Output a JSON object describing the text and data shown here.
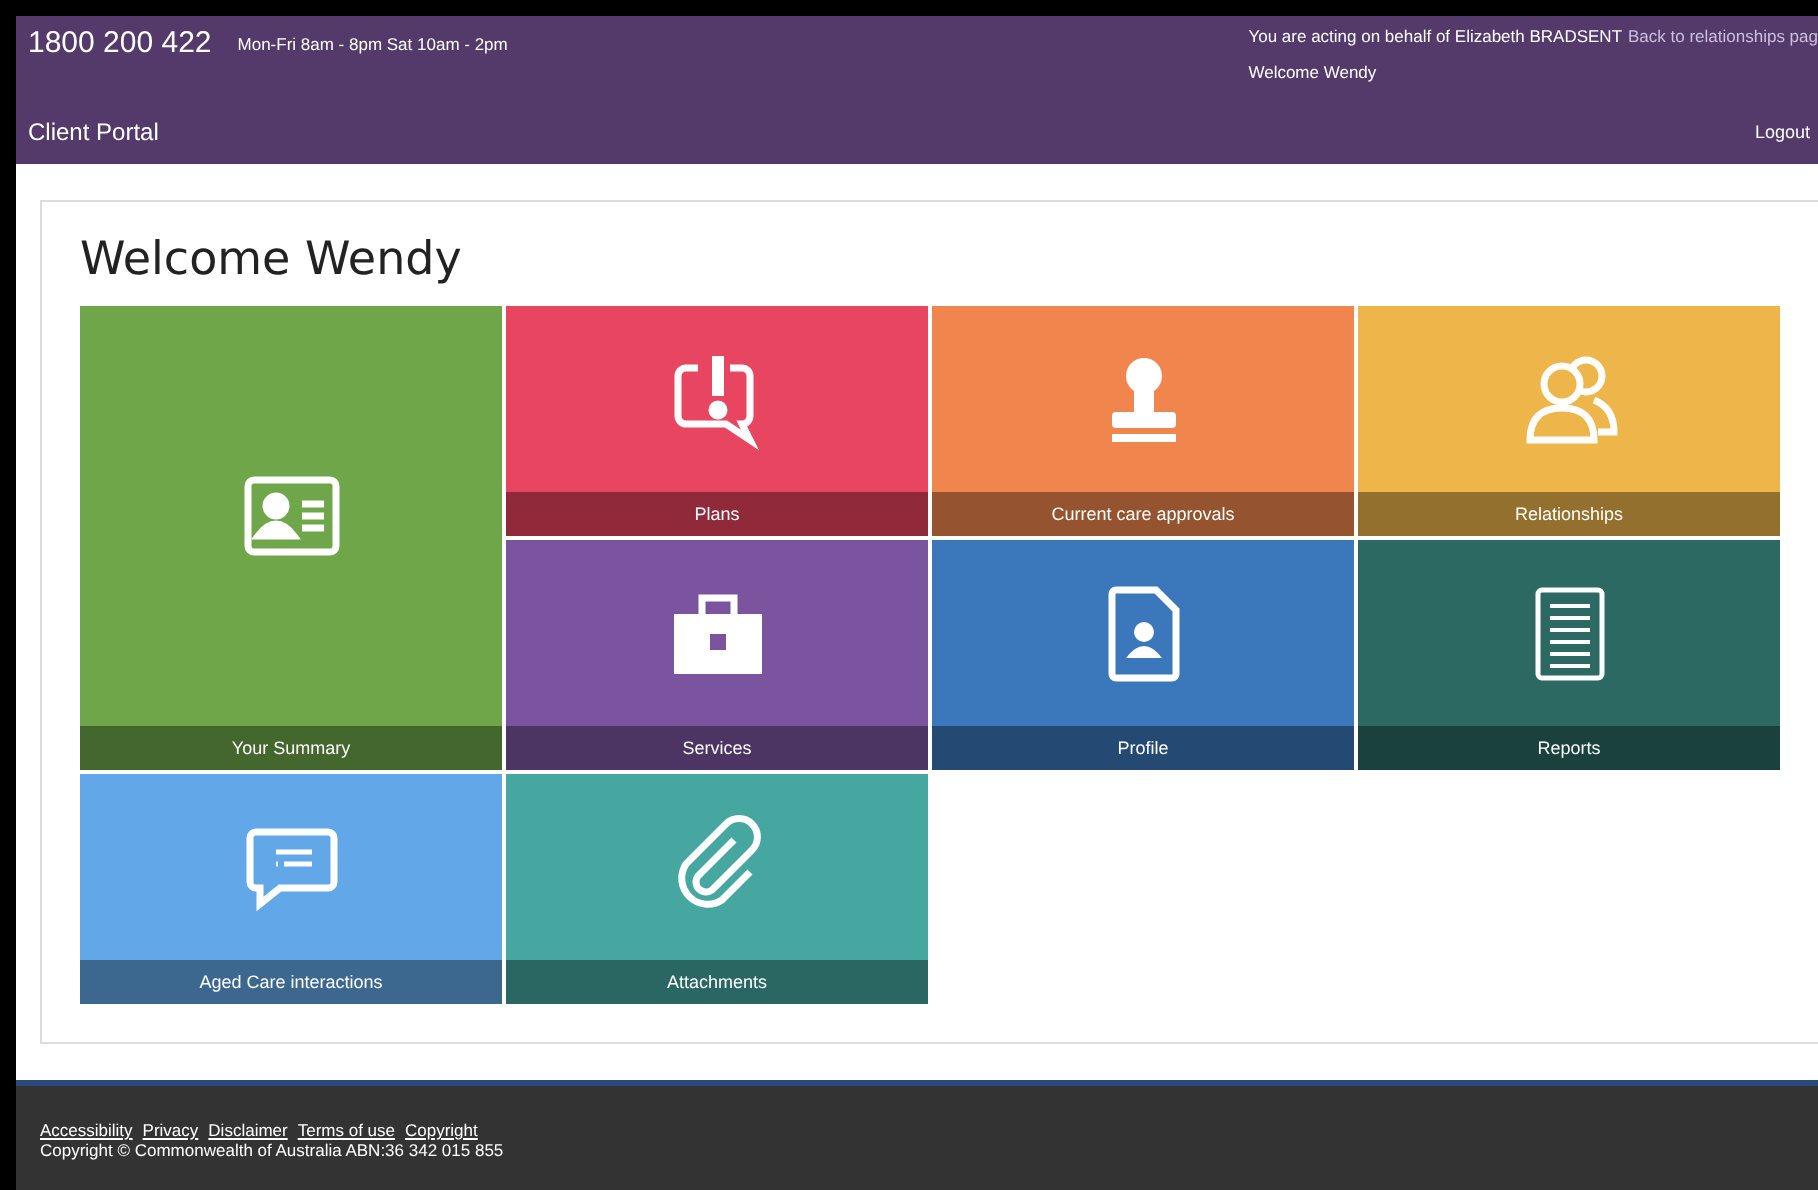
{
  "header": {
    "phone": "1800 200 422",
    "hours": "Mon-Fri 8am - 8pm Sat 10am - 2pm",
    "acting_notice": "You are acting on behalf of Elizabeth BRADSENT",
    "back_link": "Back to relationships pag",
    "welcome": "Welcome Wendy",
    "brand": "Client Portal",
    "logout": "Logout"
  },
  "heading": "Welcome Wendy",
  "tiles": [
    {
      "label": "Plans",
      "color": "#e84560",
      "tall": false
    },
    {
      "label": "Current care approvals",
      "color": "#f0864d",
      "tall": false
    },
    {
      "label": "Relationships",
      "color": "#eeb54a",
      "tall": false
    },
    {
      "label": "Your Summary",
      "color": "#6fa64a",
      "tall": true
    },
    {
      "label": "Services",
      "color": "#7b54a0",
      "tall": false
    },
    {
      "label": "Profile",
      "color": "#3b78bb",
      "tall": false
    },
    {
      "label": "Reports",
      "color": "#2b6962",
      "tall": false
    },
    {
      "label": "Aged Care interactions",
      "color": "#62a8e8",
      "tall": false
    },
    {
      "label": "Attachments",
      "color": "#45a7a0",
      "tall": false
    }
  ],
  "footer": {
    "links": [
      "Accessibility",
      "Privacy",
      "Disclaimer",
      "Terms of use",
      "Copyright"
    ],
    "copyright": "Copyright © Commonwealth of Australia ABN:36 342 015 855"
  }
}
